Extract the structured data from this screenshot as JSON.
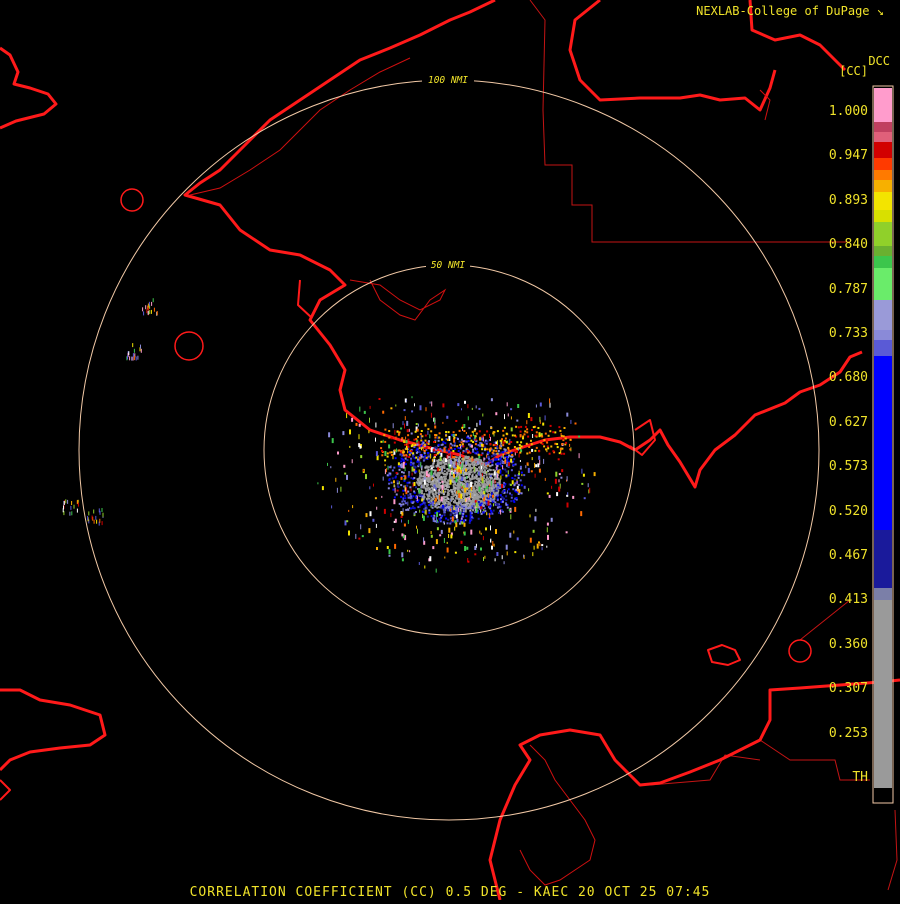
{
  "header": {
    "credit": "NEXLAB-College of DuPage",
    "credit_icon": "corner-arrow-icon"
  },
  "legend": {
    "unit_top": "DCC",
    "unit": "[CC]",
    "ticks": [
      {
        "label": "1.000",
        "value": 1.0
      },
      {
        "label": "0.947",
        "value": 0.947
      },
      {
        "label": "0.893",
        "value": 0.893
      },
      {
        "label": "0.840",
        "value": 0.84
      },
      {
        "label": "0.787",
        "value": 0.787
      },
      {
        "label": "0.733",
        "value": 0.733
      },
      {
        "label": "0.680",
        "value": 0.68
      },
      {
        "label": "0.627",
        "value": 0.627
      },
      {
        "label": "0.573",
        "value": 0.573
      },
      {
        "label": "0.520",
        "value": 0.52
      },
      {
        "label": "0.467",
        "value": 0.467
      },
      {
        "label": "0.413",
        "value": 0.413
      },
      {
        "label": "0.360",
        "value": 0.36
      },
      {
        "label": "0.307",
        "value": 0.307
      },
      {
        "label": "0.253",
        "value": 0.253
      },
      {
        "label": "TH",
        "value": null
      }
    ],
    "colors": [
      "#000000",
      "#9a9a9a",
      "#7b7fa8",
      "#1a1a9b",
      "#0000ff",
      "#5a5ad6",
      "#8a8ad8",
      "#3cc64c",
      "#90d02a",
      "#f3e400",
      "#f7b000",
      "#ff6a00",
      "#d20000",
      "#c04060",
      "#ff9ccc"
    ]
  },
  "rings": [
    {
      "label": "50 NMI",
      "range_nmi": 50
    },
    {
      "label": "100 NMI",
      "range_nmi": 100
    }
  ],
  "caption": "CORRELATION COEFFICIENT (CC) 0.5 DEG - KAEC 20 OCT 25 07:45",
  "colors": {
    "text": "#f0e32a",
    "ring": "#f2c9a6",
    "coast": "#ff1a1a",
    "border": "#cc1a1a",
    "background": "#000000"
  }
}
